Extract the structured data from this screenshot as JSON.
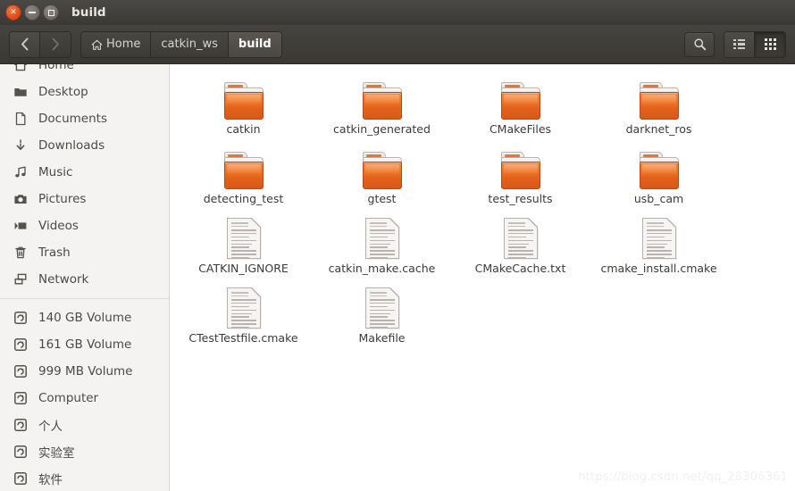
{
  "window": {
    "title": "build",
    "controls": [
      {
        "name": "close",
        "glyph": "×"
      },
      {
        "name": "minimize",
        "glyph": "–"
      },
      {
        "name": "maximize",
        "glyph": "□"
      }
    ]
  },
  "toolbar": {
    "back_label": "‹",
    "forward_label": "›",
    "search_label": "search-icon",
    "list_view_label": "list-view-icon",
    "grid_view_label": "grid-view-icon",
    "selected_view": "grid",
    "breadcrumbs": [
      {
        "label": "Home",
        "icon": "home-icon",
        "active": false
      },
      {
        "label": "catkin_ws",
        "icon": "",
        "active": false
      },
      {
        "label": "build",
        "icon": "",
        "active": true
      }
    ]
  },
  "sidebar": {
    "items": [
      {
        "label": "Home",
        "icon": "home-icon"
      },
      {
        "label": "Desktop",
        "icon": "desktop-folder-icon"
      },
      {
        "label": "Documents",
        "icon": "document-icon"
      },
      {
        "label": "Downloads",
        "icon": "download-icon"
      },
      {
        "label": "Music",
        "icon": "music-note-icon"
      },
      {
        "label": "Pictures",
        "icon": "camera-icon"
      },
      {
        "label": "Videos",
        "icon": "video-icon"
      },
      {
        "label": "Trash",
        "icon": "trash-icon"
      },
      {
        "label": "Network",
        "icon": "network-icon"
      }
    ],
    "devices": [
      {
        "label": "140 GB Volume",
        "icon": "drive-icon"
      },
      {
        "label": "161 GB Volume",
        "icon": "drive-icon"
      },
      {
        "label": "999 MB Volume",
        "icon": "drive-icon"
      },
      {
        "label": "Computer",
        "icon": "drive-icon"
      },
      {
        "label": "个人",
        "icon": "drive-icon"
      },
      {
        "label": "实验室",
        "icon": "drive-icon"
      },
      {
        "label": "软件",
        "icon": "drive-icon"
      }
    ]
  },
  "files": [
    {
      "name": "catkin",
      "type": "folder"
    },
    {
      "name": "catkin_generated",
      "type": "folder"
    },
    {
      "name": "CMakeFiles",
      "type": "folder"
    },
    {
      "name": "darknet_ros",
      "type": "folder"
    },
    {
      "name": "detecting_test",
      "type": "folder"
    },
    {
      "name": "gtest",
      "type": "folder"
    },
    {
      "name": "test_results",
      "type": "folder"
    },
    {
      "name": "usb_cam",
      "type": "folder"
    },
    {
      "name": "CATKIN_IGNORE",
      "type": "document"
    },
    {
      "name": "catkin_make.cache",
      "type": "document"
    },
    {
      "name": "CMakeCache.txt",
      "type": "document"
    },
    {
      "name": "cmake_install.cmake",
      "type": "document"
    },
    {
      "name": "CTestTestfile.cmake",
      "type": "document"
    },
    {
      "name": "Makefile",
      "type": "document"
    }
  ],
  "watermark": {
    "text": "https://blog.csdn.net/qq_28306361"
  },
  "colors": {
    "titlebar": "#3c3b37",
    "sidebar_bg": "#f4f3f1",
    "content_bg": "#ffffff",
    "folder_accent": "#ef7425",
    "close_button": "#dd4814"
  }
}
